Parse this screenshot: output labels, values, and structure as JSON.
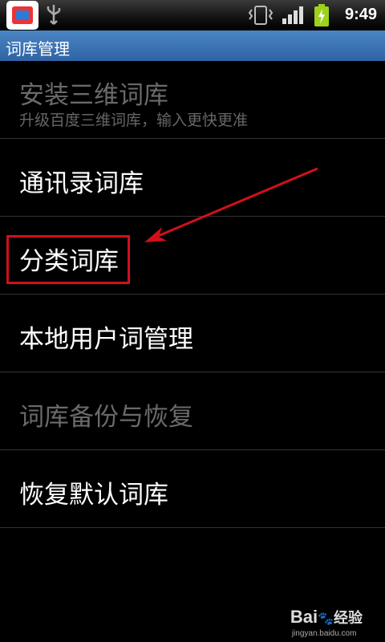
{
  "status_bar": {
    "time": "9:49",
    "icons": [
      "app-icon",
      "usb-icon",
      "vibrate-icon",
      "signal-icon",
      "battery-charging-icon"
    ]
  },
  "title_bar": {
    "title": "词库管理"
  },
  "list": [
    {
      "label": "安装三维词库",
      "summary": "升级百度三维词库，输入更快更准",
      "enabled": false
    },
    {
      "label": "通讯录词库",
      "enabled": true
    },
    {
      "label": "分类词库",
      "enabled": true,
      "highlighted": true
    },
    {
      "label": "本地用户词管理",
      "enabled": true
    },
    {
      "label": "词库备份与恢复",
      "enabled": false
    },
    {
      "label": "恢复默认词库",
      "enabled": true
    }
  ],
  "annotation": {
    "color": "#d0101a"
  },
  "watermark": {
    "brand": "Bai",
    "brand2": "经验",
    "url": "jingyan.baidu.com"
  },
  "colors": {
    "title_bar": "#3b73b4",
    "disabled_text": "#6a6a6a",
    "background": "#000000"
  }
}
